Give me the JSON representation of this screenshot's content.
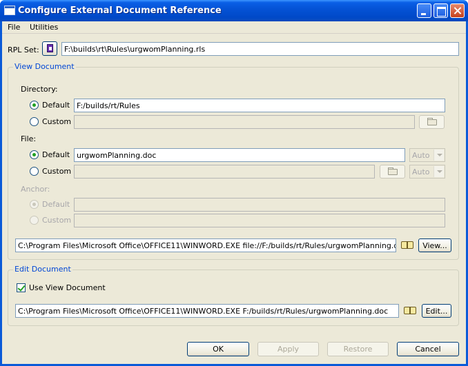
{
  "window": {
    "title": "Configure External Document Reference"
  },
  "menu": {
    "file": "File",
    "utilities": "Utilities"
  },
  "rpl": {
    "label": "RPL Set:",
    "value": "F:\\builds\\rt\\Rules\\urgwomPlanning.rls"
  },
  "view_document": {
    "legend": "View Document",
    "directory": {
      "label": "Directory:",
      "default_label": "Default",
      "default_value": "F:/builds/rt/Rules",
      "custom_label": "Custom",
      "custom_value": "",
      "selected": "Default"
    },
    "file": {
      "label": "File:",
      "default_label": "Default",
      "default_value": "urgwomPlanning.doc",
      "default_combo": "Auto",
      "custom_label": "Custom",
      "custom_value": "",
      "custom_combo": "Auto",
      "selected": "Default"
    },
    "anchor": {
      "label": "Anchor:",
      "default_label": "Default",
      "custom_label": "Custom",
      "selected": "Default"
    },
    "command": "C:\\Program Files\\Microsoft Office\\OFFICE11\\WINWORD.EXE file://F:/builds/rt/Rules/urgwomPlanning.doc",
    "view_button": "View..."
  },
  "edit_document": {
    "legend": "Edit Document",
    "use_view_label": "Use View Document",
    "use_view_checked": true,
    "command": "C:\\Program Files\\Microsoft Office\\OFFICE11\\WINWORD.EXE F:/builds/rt/Rules/urgwomPlanning.doc",
    "edit_button": "Edit..."
  },
  "buttons": {
    "ok": "OK",
    "apply": "Apply",
    "restore": "Restore",
    "cancel": "Cancel"
  },
  "icons": [
    "window-icon",
    "minimize-icon",
    "maximize-icon",
    "close-icon",
    "document-icon",
    "folder-icon",
    "book-icon",
    "dropdown-arrow-icon"
  ]
}
